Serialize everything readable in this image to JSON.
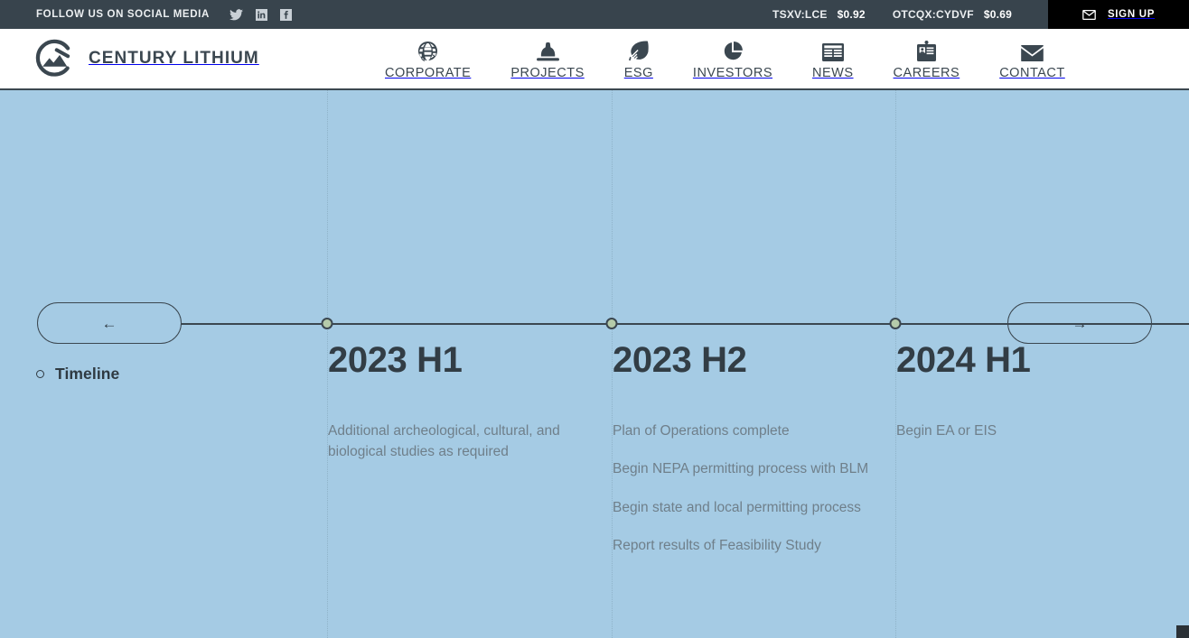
{
  "topbar": {
    "social_label": "FOLLOW US ON SOCIAL MEDIA",
    "social_icons": [
      {
        "name": "twitter-icon"
      },
      {
        "name": "linkedin-icon"
      },
      {
        "name": "facebook-icon"
      }
    ],
    "tickers": [
      {
        "symbol": "TSXV:LCE",
        "price": "$0.92"
      },
      {
        "symbol": "OTCQX:CYDVF",
        "price": "$0.69"
      }
    ],
    "signup_label": "SIGN UP",
    "signup_icon": "envelope-icon",
    "background": "#38444d",
    "signup_background": "#000000"
  },
  "header": {
    "brand_name": "CENTURY LITHIUM",
    "brand_logo_icon": "century-lithium-mountain-logo",
    "nav": [
      {
        "label": "CORPORATE",
        "icon": "globe-icon"
      },
      {
        "label": "PROJECTS",
        "icon": "hard-hat-icon"
      },
      {
        "label": "ESG",
        "icon": "leaf-icon"
      },
      {
        "label": "INVESTORS",
        "icon": "pie-chart-icon"
      },
      {
        "label": "NEWS",
        "icon": "newspaper-icon"
      },
      {
        "label": "CAREERS",
        "icon": "id-badge-icon"
      },
      {
        "label": "CONTACT",
        "icon": "envelope-icon"
      }
    ]
  },
  "timeline": {
    "section_label": "Timeline",
    "prev_label": "←",
    "next_label": "→",
    "accent_color": "#b5cbaa",
    "line_color": "#3b4750",
    "background": "#a5cbe4",
    "columns": [
      {
        "title": "2023 H1",
        "items": [
          "Additional archeological, cultural, and biological studies as required"
        ]
      },
      {
        "title": "2023 H2",
        "items": [
          "Plan of Operations complete",
          "Begin NEPA permitting process with BLM",
          "Begin state and local permitting process",
          "Report results of Feasibility Study"
        ]
      },
      {
        "title": "2024 H1",
        "items": [
          "Begin EA or EIS"
        ]
      }
    ]
  }
}
